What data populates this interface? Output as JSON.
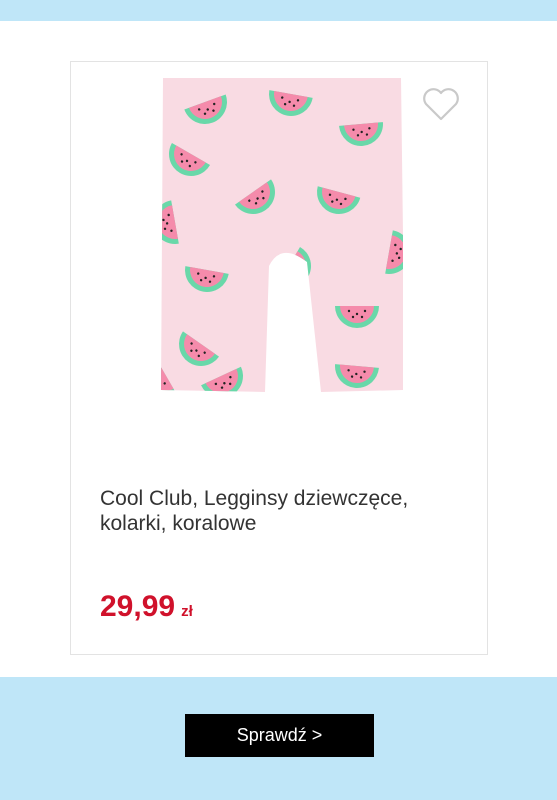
{
  "product": {
    "name": "Cool Club, Legginsy dziewczęce, kolarki, koralowe",
    "price": "29,99",
    "currency": "zł",
    "image_icon": "watermark-print-leggings-image",
    "favorite_icon": "heart-icon"
  },
  "cta": {
    "label": "Sprawdź >"
  },
  "colors": {
    "band": "#bfe6f8",
    "price": "#d0112b",
    "button": "#000000",
    "fabric": "#f9dbe3",
    "melon_flesh": "#f58bab",
    "melon_rind": "#69d8a9"
  }
}
